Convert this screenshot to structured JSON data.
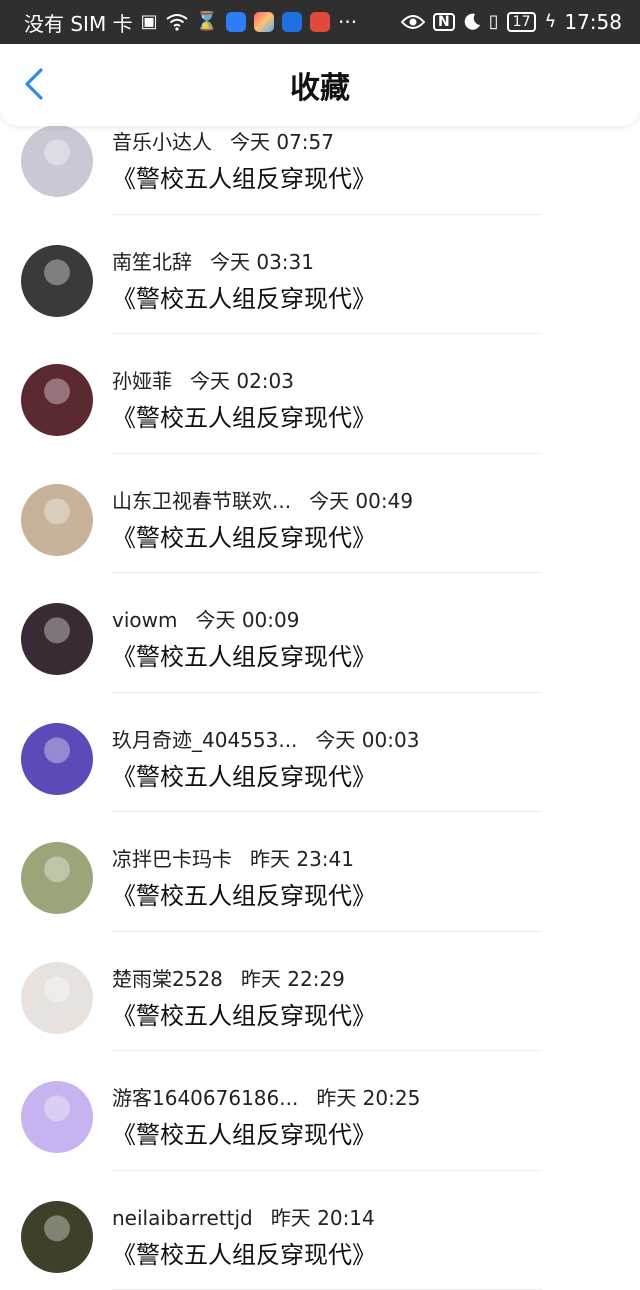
{
  "status_bar": {
    "carrier": "没有 SIM 卡",
    "more": "···",
    "nfc": "N",
    "battery": "17",
    "time": "17:58"
  },
  "header": {
    "title": "收藏"
  },
  "items": [
    {
      "user": "音乐小达人",
      "time": "今天 07:57",
      "title": "《警校五人组反穿现代》",
      "avatar_color": "#c9c9d6"
    },
    {
      "user": "南笙北辞",
      "time": "今天 03:31",
      "title": "《警校五人组反穿现代》",
      "avatar_color": "#3a3a3a"
    },
    {
      "user": "孙娅菲",
      "time": "今天 02:03",
      "title": "《警校五人组反穿现代》",
      "avatar_color": "#5a2a30"
    },
    {
      "user": "山东卫视春节联欢...",
      "time": "今天 00:49",
      "title": "《警校五人组反穿现代》",
      "avatar_color": "#c8b29a"
    },
    {
      "user": "viowm",
      "time": "今天 00:09",
      "title": "《警校五人组反穿现代》",
      "avatar_color": "#3a2a35"
    },
    {
      "user": "玖月奇迹_404553...",
      "time": "今天 00:03",
      "title": "《警校五人组反穿现代》",
      "avatar_color": "#5b4bb8"
    },
    {
      "user": "凉拌巴卡玛卡",
      "time": "昨天 23:41",
      "title": "《警校五人组反穿现代》",
      "avatar_color": "#9aa67a"
    },
    {
      "user": "楚雨棠2528",
      "time": "昨天 22:29",
      "title": "《警校五人组反穿现代》",
      "avatar_color": "#e8e2de"
    },
    {
      "user": "游客1640676186...",
      "time": "昨天 20:25",
      "title": "《警校五人组反穿现代》",
      "avatar_color": "#c6b3ef"
    },
    {
      "user": "neilaibarrettjd",
      "time": "昨天 20:14",
      "title": "《警校五人组反穿现代》",
      "avatar_color": "#40402a"
    }
  ]
}
